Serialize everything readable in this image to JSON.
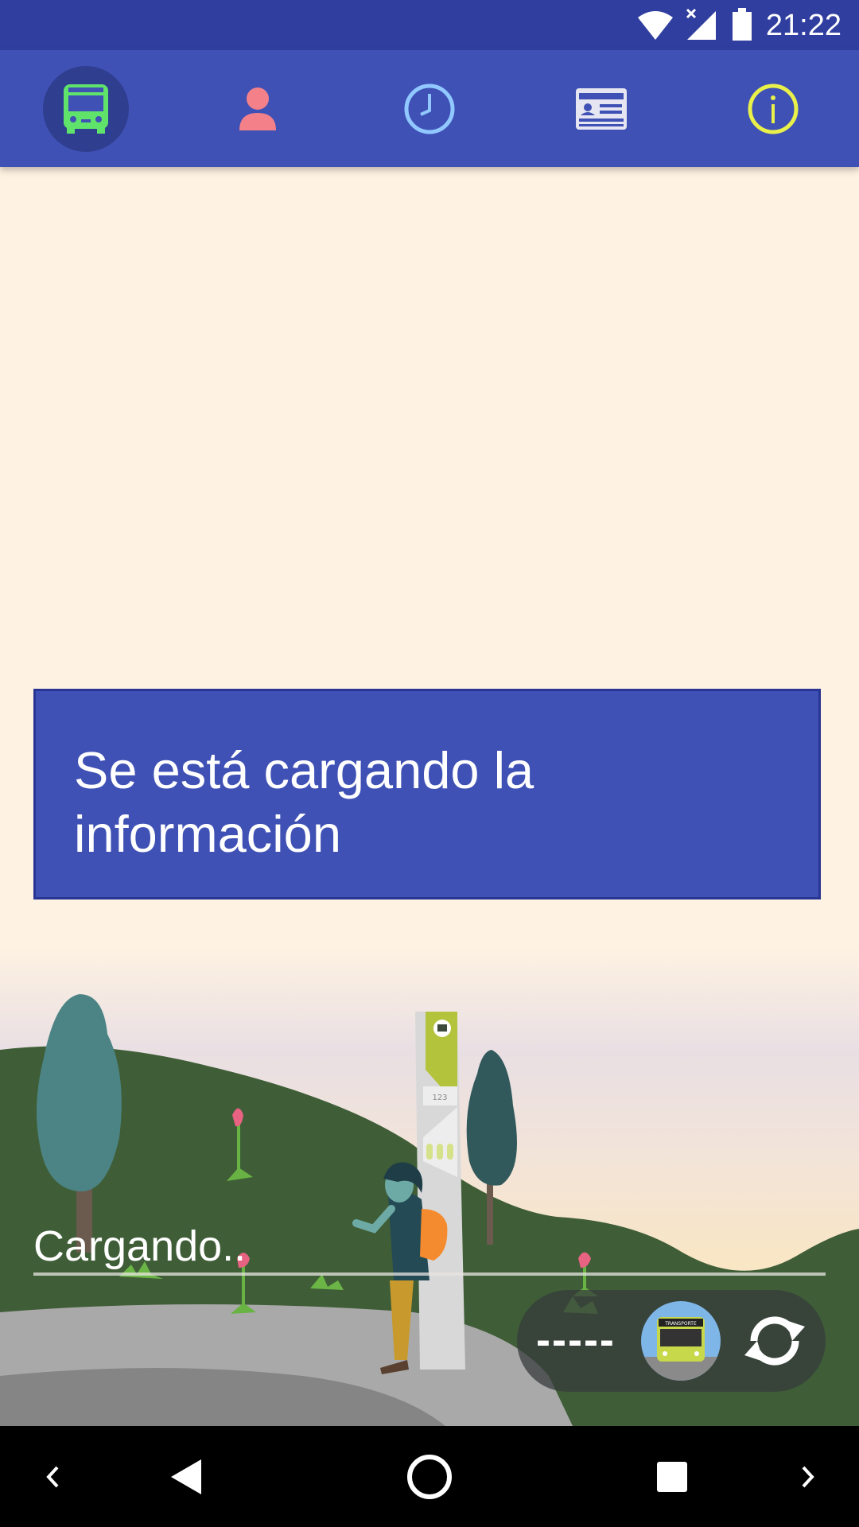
{
  "status_bar": {
    "time": "21:22"
  },
  "tabs": [
    {
      "name": "bus",
      "icon": "bus-icon",
      "selected": true
    },
    {
      "name": "user",
      "icon": "person-icon"
    },
    {
      "name": "history",
      "icon": "clock-icon"
    },
    {
      "name": "card",
      "icon": "id-card-icon"
    },
    {
      "name": "info",
      "icon": "info-icon"
    }
  ],
  "loading": {
    "message": "Se está cargando la información"
  },
  "search": {
    "value": "Cargando.."
  },
  "stop": {
    "code": "-----",
    "bus_sign": "TRANSPORTE"
  },
  "colors": {
    "primary": "#3F51B5",
    "primary_dark": "#303F9F",
    "background": "#FEF2E2",
    "bus_green": "#5FE36B",
    "person_pink": "#F48189",
    "clock_blue": "#90C8FF",
    "info_yellow": "#E9F04A"
  }
}
